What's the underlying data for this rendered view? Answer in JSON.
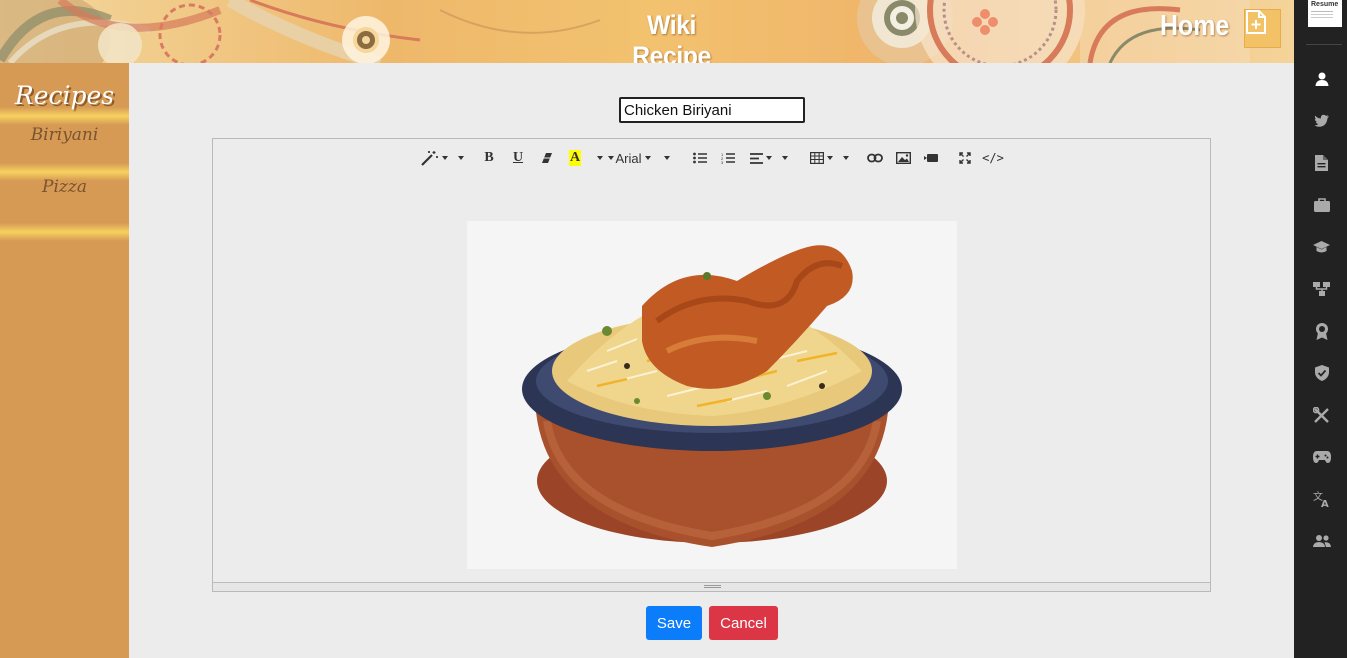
{
  "header": {
    "title": "Wiki Recipe",
    "home_label": "Home",
    "add_icon": "add-document-icon"
  },
  "sidebar": {
    "heading": "Recipes",
    "items": [
      {
        "label": "Biriyani"
      },
      {
        "label": "Pizza"
      }
    ]
  },
  "right_bar": {
    "thumb_label": "Resume",
    "icons": [
      "user-icon",
      "twitter-icon",
      "file-icon",
      "briefcase-icon",
      "graduation-cap-icon",
      "sitemap-icon",
      "award-icon",
      "shield-check-icon",
      "tools-icon",
      "gamepad-icon",
      "language-icon",
      "users-icon"
    ]
  },
  "editor": {
    "title_value": "Chicken Biriyani",
    "font_name": "Arial",
    "toolbar_icons": [
      "magic-wand-icon",
      "bold-icon",
      "underline-icon",
      "eraser-icon",
      "highlight-icon",
      "font-family-dropdown",
      "font-size-dropdown",
      "unordered-list-icon",
      "ordered-list-icon",
      "align-icon",
      "table-icon",
      "link-icon",
      "picture-icon",
      "video-icon",
      "fullscreen-icon",
      "code-view-icon"
    ],
    "highlight_color": "#ffff00"
  },
  "actions": {
    "save_label": "Save",
    "cancel_label": "Cancel"
  },
  "colors": {
    "sidebar": "#d69a55",
    "save": "#0b7dfa",
    "cancel": "#dc3545",
    "right_bar": "#222222"
  }
}
